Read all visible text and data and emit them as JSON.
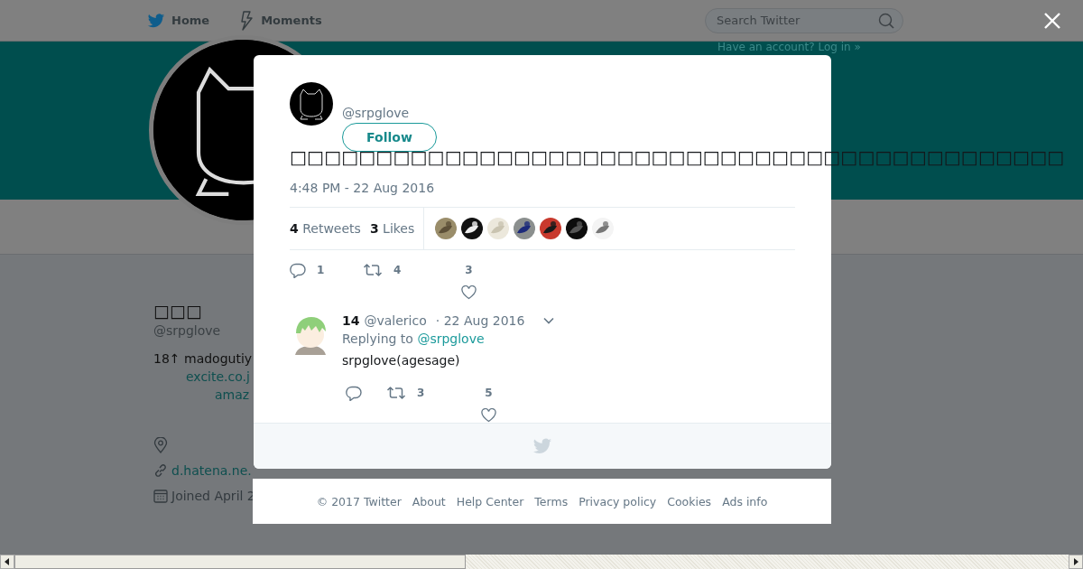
{
  "nav": {
    "items": [
      {
        "label": "Home"
      },
      {
        "label": "Moments"
      }
    ],
    "search": {
      "placeholder": "Search Twitter"
    },
    "login_prompt": "Have an account? Log in »"
  },
  "profile": {
    "name": "□□□",
    "handle": "@srpglove",
    "bio": "18↑ madogutiy",
    "bio_links": [
      "excite.co.j",
      "amaz"
    ],
    "website": "d.hatena.ne.",
    "joined": "Joined April 2"
  },
  "modal": {
    "tweet": {
      "handle": "@srpglove",
      "follow_label": "Follow",
      "text": "□□□□□□□□□□□□□□□□□□□□□□□□□□□□□□□□□□□□□□□□□□□□□",
      "time": "4:48 PM - 22 Aug 2016",
      "retweets": {
        "count": "4",
        "label": "Retweets"
      },
      "likes": {
        "count": "3",
        "label": "Likes"
      },
      "actions": {
        "replies": "1",
        "retweets": "4",
        "likes": "3"
      }
    },
    "reply": {
      "name": "14",
      "handle": "@valerico",
      "date": "· 22 Aug 2016",
      "replying_label": "Replying to",
      "replying_to": "@srpglove",
      "text": "srpglove(agesage)",
      "actions": {
        "retweets": "3",
        "likes": "5"
      }
    }
  },
  "footer": [
    "© 2017 Twitter",
    "About",
    "Help Center",
    "Terms",
    "Privacy policy",
    "Cookies",
    "Ads info"
  ]
}
